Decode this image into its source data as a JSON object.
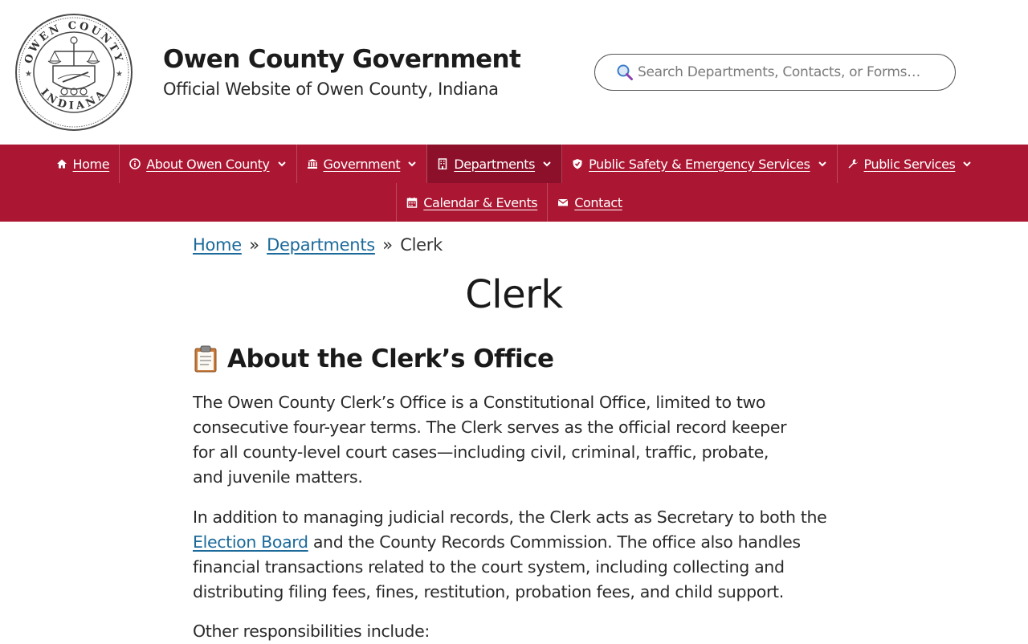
{
  "header": {
    "title": "Owen County Government",
    "tagline": "Official Website of Owen County, Indiana",
    "seal_text_top": "OWEN COUNTY",
    "seal_text_bottom": "INDIANA"
  },
  "search": {
    "placeholder": "Search Departments, Contacts, or Forms…"
  },
  "nav": {
    "row1": [
      {
        "label": "Home",
        "icon": "home-icon"
      },
      {
        "label": "About Owen County",
        "icon": "info-icon",
        "dropdown": true
      },
      {
        "label": "Government",
        "icon": "bank-icon",
        "dropdown": true
      },
      {
        "label": "Departments",
        "icon": "building-icon",
        "dropdown": true,
        "active": true
      },
      {
        "label": "Public Safety & Emergency Services",
        "icon": "shield-icon",
        "dropdown": true
      },
      {
        "label": "Public Services",
        "icon": "wrench-icon",
        "dropdown": true
      }
    ],
    "row2": [
      {
        "label": "Calendar & Events",
        "icon": "calendar-icon"
      },
      {
        "label": "Contact",
        "icon": "envelope-icon"
      }
    ]
  },
  "breadcrumb": {
    "home": "Home",
    "departments": "Departments",
    "current": "Clerk",
    "separator": "»"
  },
  "page": {
    "title": "Clerk",
    "section_title": "About the Clerk’s Office",
    "p1": "The Owen County Clerk’s Office is a Constitutional Office, limited to two consecutive four-year terms. The Clerk serves as the official record keeper for all county-level court cases—including civil, criminal, traffic, probate, and juvenile matters.",
    "p2_before": "In addition to managing judicial records, the Clerk acts as Secretary to both the ",
    "p2_link": "Election Board",
    "p2_after": " and the County Records Commission. The office also handles financial transactions related to the court system, including collecting and distributing filing fees, fines, restitution, probation fees, and child support.",
    "p3": "Other responsibilities include:"
  },
  "colors": {
    "nav_bg": "#ab1632",
    "nav_active": "#8c1029",
    "link": "#1b6a9a"
  }
}
